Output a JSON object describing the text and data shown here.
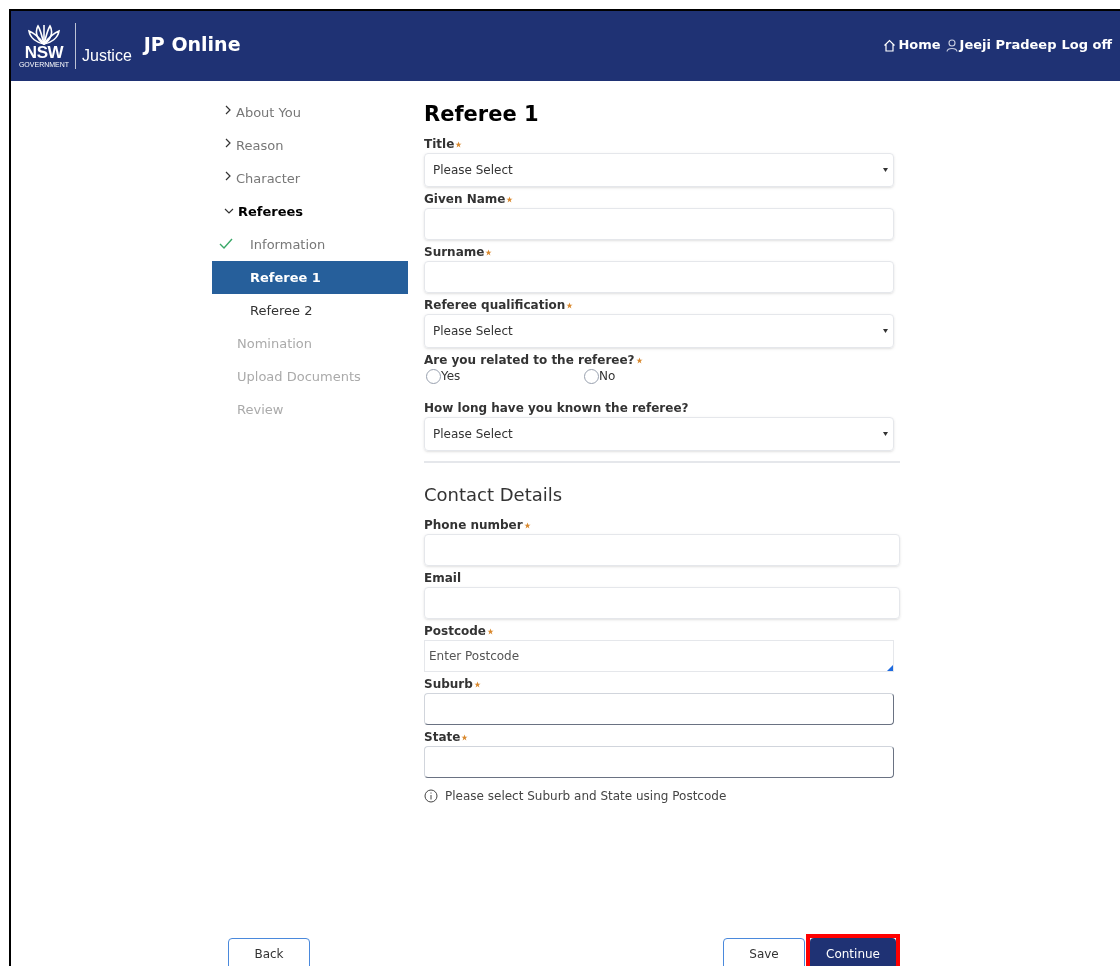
{
  "header": {
    "logo": {
      "wordmark": "NSW",
      "sub": "GOVERNMENT",
      "agency": "Justice"
    },
    "app_title": "JP Online",
    "links": [
      {
        "kind": "home",
        "label": "Home"
      },
      {
        "kind": "user",
        "label": "Jeeji Pradeep"
      },
      {
        "kind": "plain",
        "label": "Log off"
      }
    ]
  },
  "sidebar": {
    "items": [
      {
        "label": "About You",
        "kind": "section",
        "expanded": false
      },
      {
        "label": "Reason",
        "kind": "section",
        "expanded": false
      },
      {
        "label": "Character",
        "kind": "section",
        "expanded": false
      },
      {
        "label": "Referees",
        "kind": "section",
        "expanded": true,
        "children": [
          {
            "label": "Information",
            "done": true,
            "selected": false
          },
          {
            "label": "Referee 1",
            "done": false,
            "selected": true
          },
          {
            "label": "Referee 2",
            "done": false,
            "selected": false
          }
        ]
      },
      {
        "label": "Nomination",
        "kind": "step"
      },
      {
        "label": "Upload Documents",
        "kind": "step"
      },
      {
        "label": "Review",
        "kind": "step"
      }
    ]
  },
  "form": {
    "title": "Referee 1",
    "sections": [
      {
        "fields": [
          {
            "kind": "select",
            "label": "Title",
            "required": true,
            "value": "Please Select"
          },
          {
            "kind": "text",
            "label": "Given Name",
            "required": true
          },
          {
            "kind": "text",
            "label": "Surname",
            "required": true
          },
          {
            "kind": "select",
            "label": "Referee qualification",
            "required": true,
            "value": "Please Select"
          },
          {
            "kind": "radio",
            "label": "Are you related to the referee?",
            "required": true,
            "options": [
              {
                "label": "Yes",
                "selected": false
              },
              {
                "label": "No",
                "selected": false
              }
            ]
          },
          {
            "kind": "select",
            "label": "How long have you known the referee?",
            "required": false,
            "value": "Please Select"
          }
        ]
      },
      {
        "heading": "Contact Details",
        "fields": [
          {
            "kind": "text",
            "label": "Phone number",
            "required": true
          },
          {
            "kind": "text",
            "label": "Email",
            "required": false
          },
          {
            "kind": "lookup",
            "label": "Postcode",
            "required": true,
            "placeholder": "Enter Postcode"
          },
          {
            "kind": "text",
            "label": "Suburb",
            "required": true,
            "readonly": true
          },
          {
            "kind": "text",
            "label": "State",
            "required": true,
            "readonly": true
          }
        ],
        "note": "Please select Suburb and State using Postcode"
      }
    ]
  },
  "footer": {
    "buttons": [
      {
        "label": "Back",
        "kind": "secondary",
        "highlighted": false
      },
      {
        "label": "Save",
        "kind": "secondary",
        "highlighted": false
      },
      {
        "label": "Continue",
        "kind": "primary",
        "highlighted": true
      }
    ]
  }
}
